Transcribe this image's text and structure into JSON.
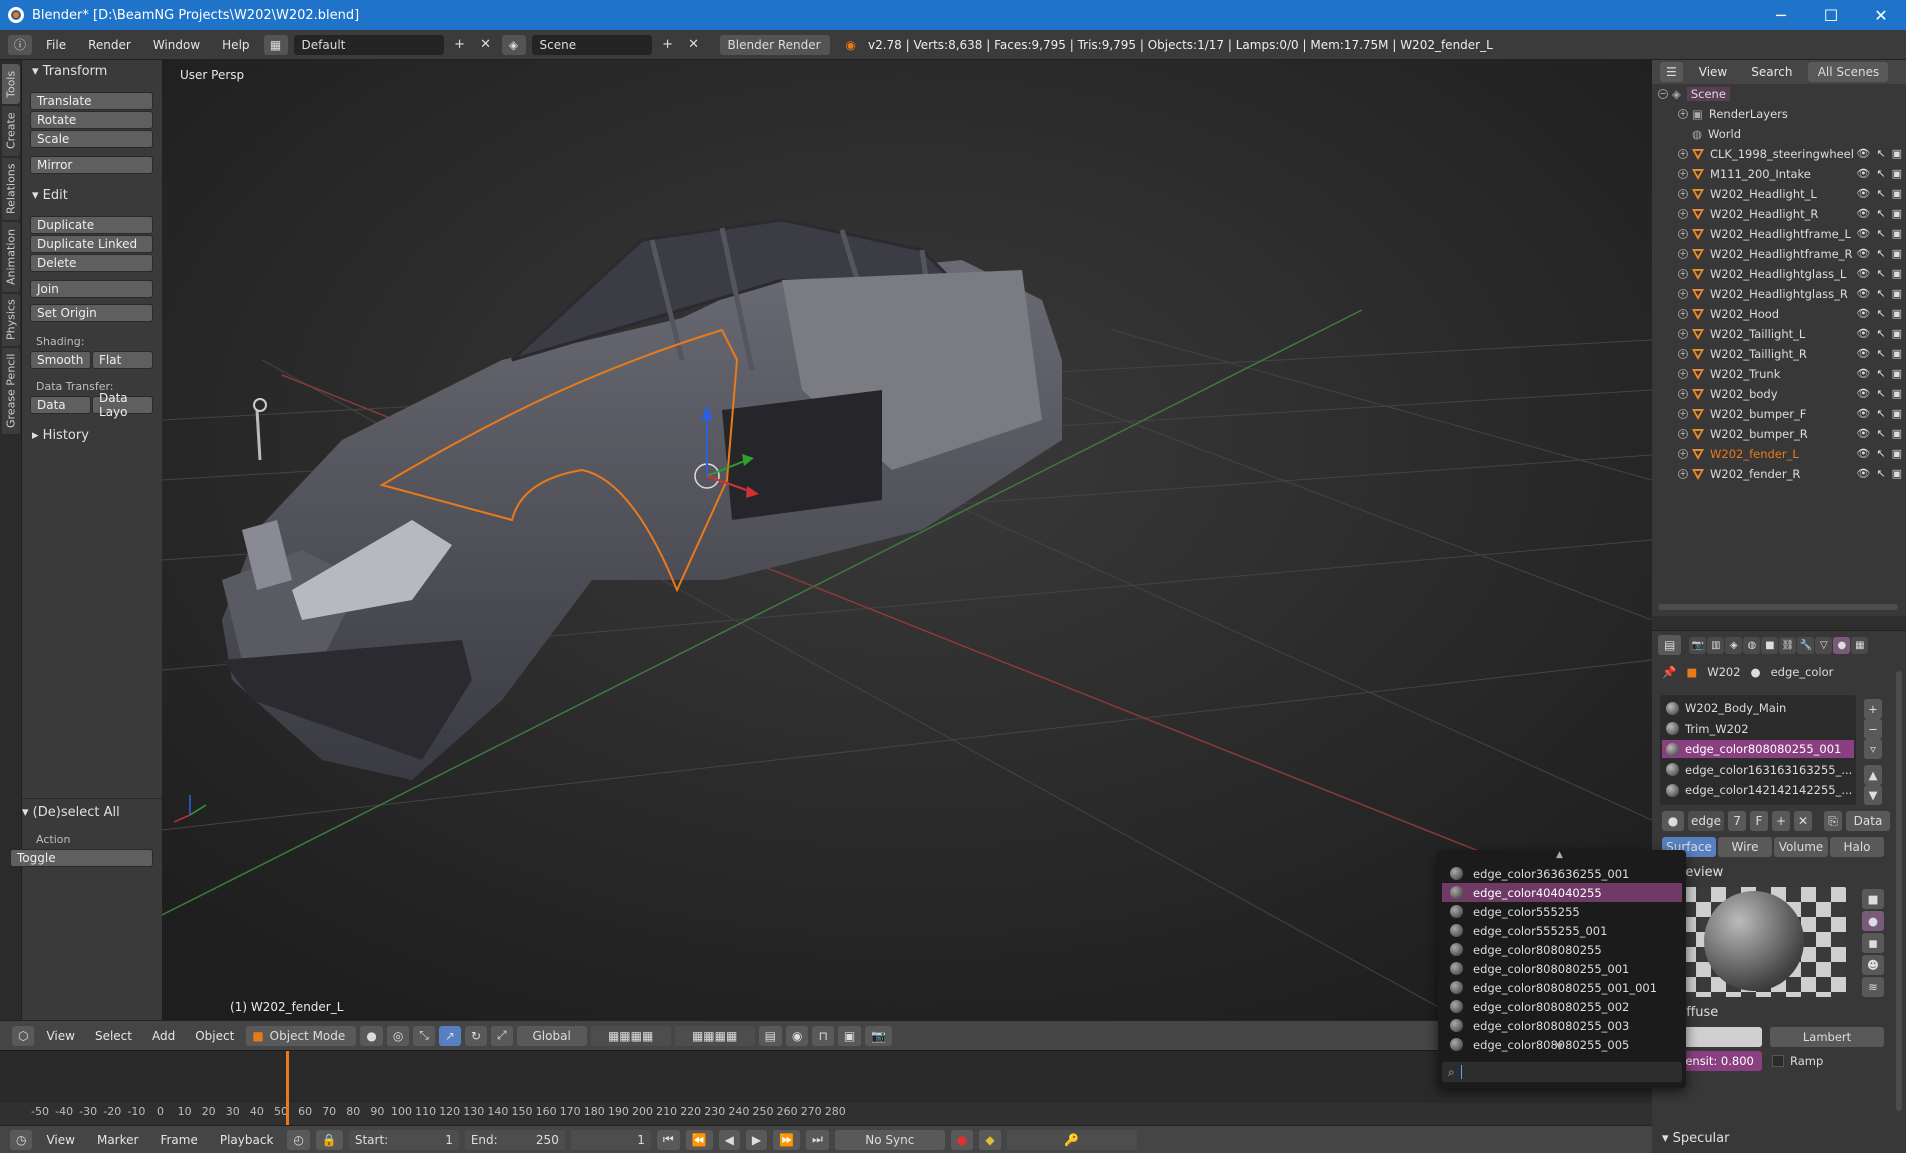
{
  "window": {
    "title": "Blender* [D:\\BeamNG Projects\\W202\\W202.blend]",
    "minimize": "─",
    "maximize": "☐",
    "close": "✕"
  },
  "infobar": {
    "menus": [
      "File",
      "Render",
      "Window",
      "Help"
    ],
    "layout": "Default",
    "scene": "Scene",
    "engine": "Blender Render",
    "stats": "v2.78 | Verts:8,638 | Faces:9,795 | Tris:9,795 | Objects:1/17 | Lamps:0/0 | Mem:17.75M | W202_fender_L"
  },
  "toolshelf_tabs": [
    "Tools",
    "Create",
    "Relations",
    "Animation",
    "Physics",
    "Grease Pencil"
  ],
  "toolshelf": {
    "transform_header": "Transform",
    "translate": "Translate",
    "rotate": "Rotate",
    "scale": "Scale",
    "mirror": "Mirror",
    "edit_header": "Edit",
    "duplicate": "Duplicate",
    "duplicate_linked": "Duplicate Linked",
    "delete": "Delete",
    "join": "Join",
    "set_origin": "Set Origin",
    "shading_label": "Shading:",
    "smooth": "Smooth",
    "flat": "Flat",
    "data_transfer_label": "Data Transfer:",
    "data": "Data",
    "data_layo": "Data Layo",
    "history_header": "History",
    "deselect_header": "(De)select All",
    "action_label": "Action",
    "action_value": "Toggle"
  },
  "viewport": {
    "view_name": "User Persp",
    "active_object": "(1) W202_fender_L"
  },
  "viewport_header": {
    "menus": [
      "View",
      "Select",
      "Add",
      "Object"
    ],
    "mode": "Object Mode",
    "orientation": "Global"
  },
  "timeline": {
    "ticks": [
      "-50",
      "-40",
      "-30",
      "-20",
      "-10",
      "0",
      "10",
      "20",
      "30",
      "40",
      "50",
      "60",
      "70",
      "80",
      "90",
      "100",
      "110",
      "120",
      "130",
      "140",
      "150",
      "160",
      "170",
      "180",
      "190",
      "200",
      "210",
      "220",
      "230",
      "240",
      "250",
      "260",
      "270",
      "280"
    ],
    "current_frame_tick": "0"
  },
  "timeline_header": {
    "menus": [
      "View",
      "Marker",
      "Frame",
      "Playback"
    ],
    "start_label": "Start:",
    "start_value": "1",
    "end_label": "End:",
    "end_value": "250",
    "current_frame": "1",
    "sync": "No Sync"
  },
  "outliner": {
    "header_view": "View",
    "header_search": "Search",
    "header_scenes": "All Scenes",
    "scene": "Scene",
    "render_layers": "RenderLayers",
    "world": "World",
    "objects": [
      "CLK_1998_steeringwheel",
      "M111_200_Intake",
      "W202_Headlight_L",
      "W202_Headlight_R",
      "W202_Headlightframe_L",
      "W202_Headlightframe_R",
      "W202_Headlightglass_L",
      "W202_Headlightglass_R",
      "W202_Hood",
      "W202_Taillight_L",
      "W202_Taillight_R",
      "W202_Trunk",
      "W202_body",
      "W202_bumper_F",
      "W202_bumper_R",
      "W202_fender_L",
      "W202_fender_R"
    ],
    "selected_object": "W202_fender_L"
  },
  "properties": {
    "breadcrumb_object": "W202",
    "breadcrumb_material": "edge_color",
    "material_slots": [
      "W202_Body_Main",
      "Trim_W202",
      "edge_color808080255_001",
      "edge_color163163163255_...",
      "edge_color142142142255_..."
    ],
    "selected_slot": "edge_color808080255_001",
    "mat_name": "edge",
    "mat_users": "7",
    "mat_fake": "F",
    "data_link": "Data",
    "tabs": [
      "Surface",
      "Wire",
      "Volume",
      "Halo"
    ],
    "preview_label": "Preview",
    "diffuse_label": "Diffuse",
    "diffuse_shader": "Lambert",
    "intensity": "Intensit: 0.800",
    "ramp": "Ramp",
    "specular_label": "Specular"
  },
  "dropdown": {
    "items": [
      "edge_color363636255_001",
      "edge_color404040255",
      "edge_color555255",
      "edge_color555255_001",
      "edge_color808080255",
      "edge_color808080255_001",
      "edge_color808080255_001_001",
      "edge_color808080255_002",
      "edge_color808080255_003",
      "edge_color808080255_005"
    ],
    "selected": "edge_color404040255",
    "search_value": ""
  },
  "colors": {
    "accent": "#ea7a19",
    "title_bar": "#1f73c9",
    "selection": "#8a3f80"
  }
}
